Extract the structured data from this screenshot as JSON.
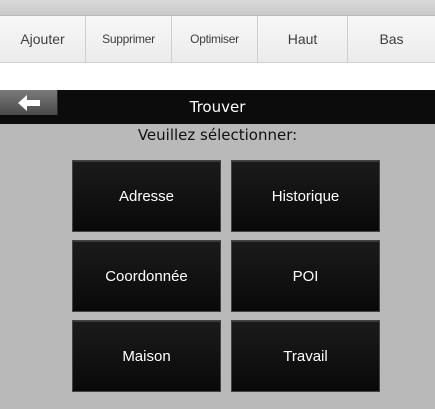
{
  "toolbar": {
    "buttons": [
      {
        "label": "Ajouter"
      },
      {
        "label": "Supprimer"
      },
      {
        "label": "Optimiser"
      },
      {
        "label": "Haut"
      },
      {
        "label": "Bas"
      }
    ]
  },
  "find": {
    "title": "Trouver",
    "subtitle": "Veuillez sélectionner:",
    "options": [
      {
        "label": "Adresse"
      },
      {
        "label": "Historique"
      },
      {
        "label": "Coordonnée"
      },
      {
        "label": "POI"
      },
      {
        "label": "Maison"
      },
      {
        "label": "Travail"
      }
    ]
  },
  "colors": {
    "titlebar": "#0c0c0c",
    "background": "#b9b9b9",
    "button": "#111111"
  },
  "icons": {
    "back": "arrow-left-icon"
  }
}
